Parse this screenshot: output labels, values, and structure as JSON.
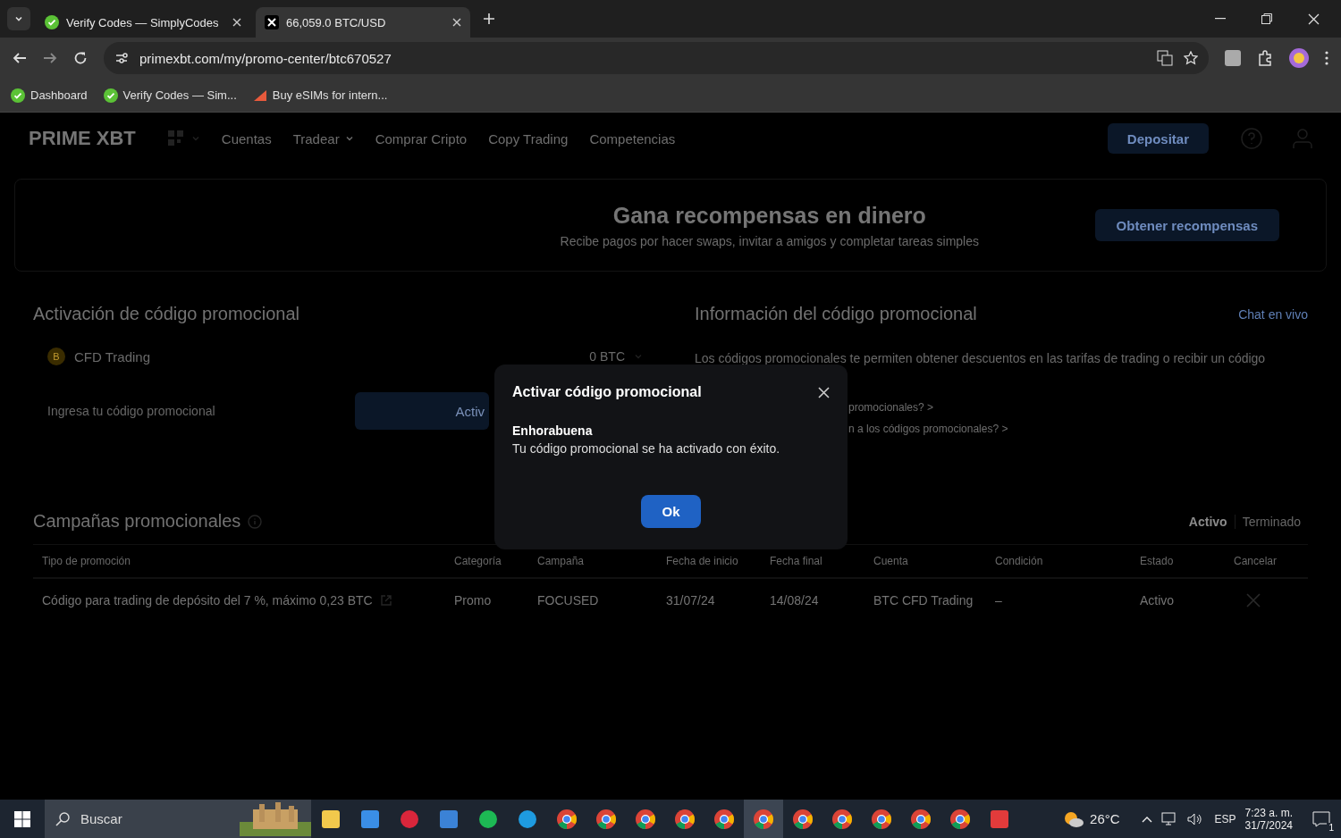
{
  "browser": {
    "tabs": [
      {
        "title": "Verify Codes — SimplyCodes",
        "selected": false
      },
      {
        "title": "66,059.0 BTC/USD",
        "selected": true
      }
    ],
    "url": "primexbt.com/my/promo-center/btc670527",
    "bookmarks": [
      "Dashboard",
      "Verify Codes — Sim...",
      "Buy eSIMs for intern..."
    ]
  },
  "nav": {
    "logo": "PRIME XBT",
    "items": [
      {
        "label": "Cuentas",
        "caret": false
      },
      {
        "label": "Tradear",
        "caret": true
      },
      {
        "label": "Comprar Cripto",
        "caret": false
      },
      {
        "label": "Copy Trading",
        "caret": false
      },
      {
        "label": "Competencias",
        "caret": false
      }
    ],
    "deposit": "Depositar"
  },
  "banner": {
    "title": "Gana recompensas en dinero",
    "subtitle": "Recibe pagos por hacer swaps, invitar a amigos y completar tareas simples",
    "button": "Obtener recompensas"
  },
  "activation": {
    "title": "Activación de código promocional",
    "coin": "B",
    "account": "CFD Trading",
    "balance": "0 BTC",
    "placeholder": "Ingresa tu código promocional",
    "button": "Activ"
  },
  "info": {
    "title": "Información del código promocional",
    "chat": "Chat en vivo",
    "text": "Los códigos promocionales te permiten obtener descuentos en las tarifas de trading o recibir un código",
    "links": [
      "promocionales? >",
      "n a los códigos promocionales? >"
    ]
  },
  "campaigns": {
    "title": "Campañas promocionales",
    "filters": [
      {
        "label": "Activo",
        "selected": true
      },
      {
        "label": "Terminado",
        "selected": false
      }
    ],
    "columns": [
      "Tipo de promoción",
      "Categoría",
      "Campaña",
      "Fecha de inicio",
      "Fecha final",
      "Cuenta",
      "Condición",
      "Estado",
      "Cancelar"
    ],
    "rows": [
      {
        "type": "Código para trading de depósito del 7 %, máximo 0,23 BTC",
        "category": "Promo",
        "campaign": "FOCUSED",
        "start": "31/07/24",
        "end": "14/08/24",
        "account": "BTC CFD Trading",
        "condition": "–",
        "status": "Activo"
      }
    ]
  },
  "modal": {
    "title": "Activar código promocional",
    "heading": "Enhorabuena",
    "message": "Tu código promocional se ha activado con éxito.",
    "button": "Ok"
  },
  "taskbar": {
    "search": "Buscar",
    "temperature": "26°C",
    "language": "ESP",
    "time": "7:23 a. m.",
    "date": "31/7/2024",
    "notifications": "1"
  }
}
